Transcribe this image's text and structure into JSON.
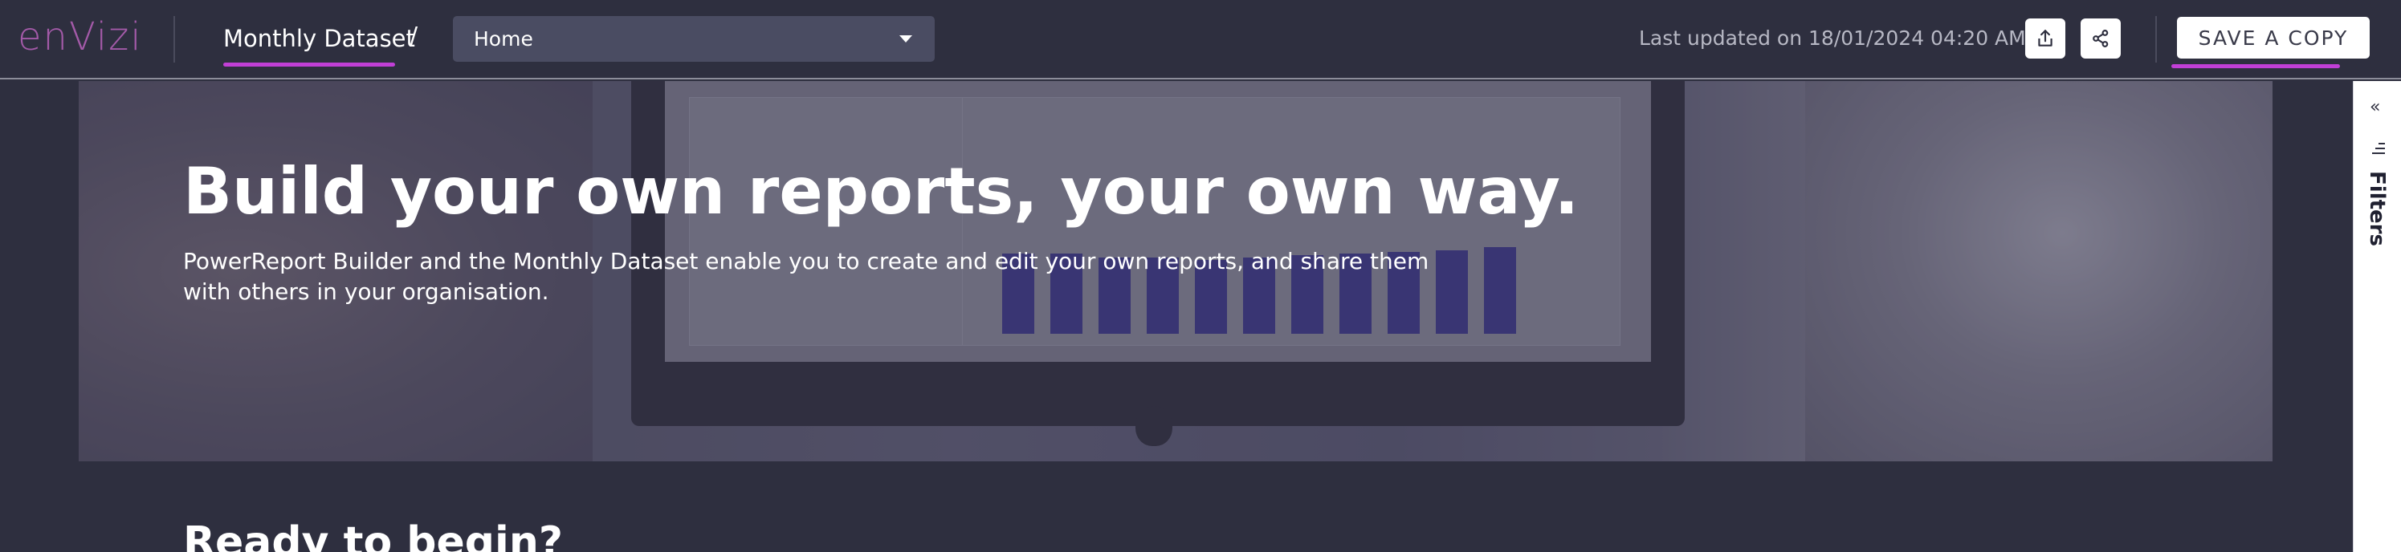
{
  "header": {
    "logo_text": "enVizi",
    "dataset_title": "Monthly Dataset",
    "breadcrumb_separator": "/",
    "page_select": {
      "selected": "Home"
    },
    "last_updated": "Last updated on 18/01/2024 04:20 AM",
    "export_icon": "export-icon",
    "share_icon": "share-icon",
    "save_copy_label": "SAVE A COPY",
    "accent_color": "#c13fd6"
  },
  "hero": {
    "title": "Build your own reports, your own way.",
    "description": "PowerReport Builder and the Monthly Dataset enable you to create and edit your own reports, and share them with others in your organisation."
  },
  "section": {
    "title": "Ready to begin?"
  },
  "filters": {
    "label": "Filters",
    "collapse_icon": "double-chevron-left-icon",
    "filter_icon": "filter-lines-icon"
  }
}
